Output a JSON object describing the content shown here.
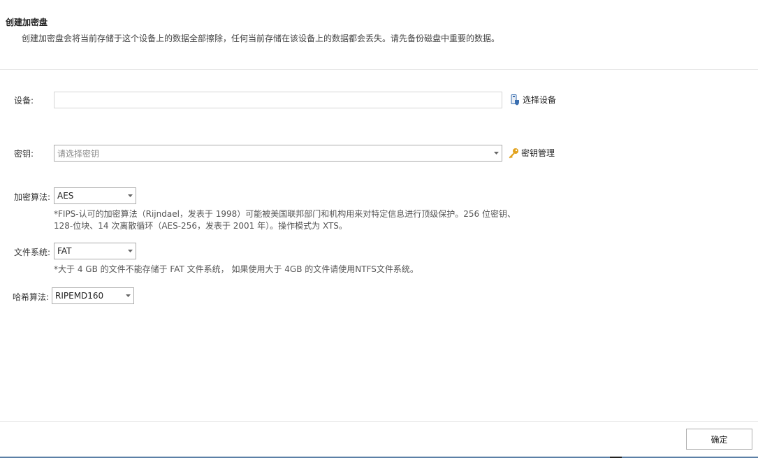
{
  "header": {
    "title": "创建加密盘",
    "description": "创建加密盘会将当前存储于这个设备上的数据全部擦除，任何当前存储在该设备上的数据都会丢失。请先备份磁盘中重要的数据。"
  },
  "device": {
    "label": "设备:",
    "value": "",
    "select_button": "选择设备",
    "icon": "usb-drive-shield-icon"
  },
  "key": {
    "label": "密钥:",
    "placeholder": "请选择密钥",
    "manage_button": "密钥管理",
    "icon": "key-icon"
  },
  "encryption": {
    "label": "加密算法:",
    "selected": "AES",
    "note_line1": "*FIPS-认可的加密算法（Rijndael，发表于 1998）可能被美国联邦部门和机构用来对特定信息进行顶级保护。256 位密钥、",
    "note_line2": "128-位块、14 次离散循环（AES-256，发表于 2001 年）。操作模式为 XTS。"
  },
  "filesystem": {
    "label": "文件系统:",
    "selected": "FAT",
    "note": "*大于 4 GB 的文件不能存储于 FAT 文件系统， 如果使用大于 4GB 的文件请使用NTFS文件系统。"
  },
  "hash": {
    "label": "哈希算法:",
    "selected": "RIPEMD160"
  },
  "footer": {
    "ok_label": "确定"
  },
  "colors": {
    "key_icon": "#e2a21d",
    "device_icon": "#3a6fb0",
    "border": "#ababab"
  }
}
